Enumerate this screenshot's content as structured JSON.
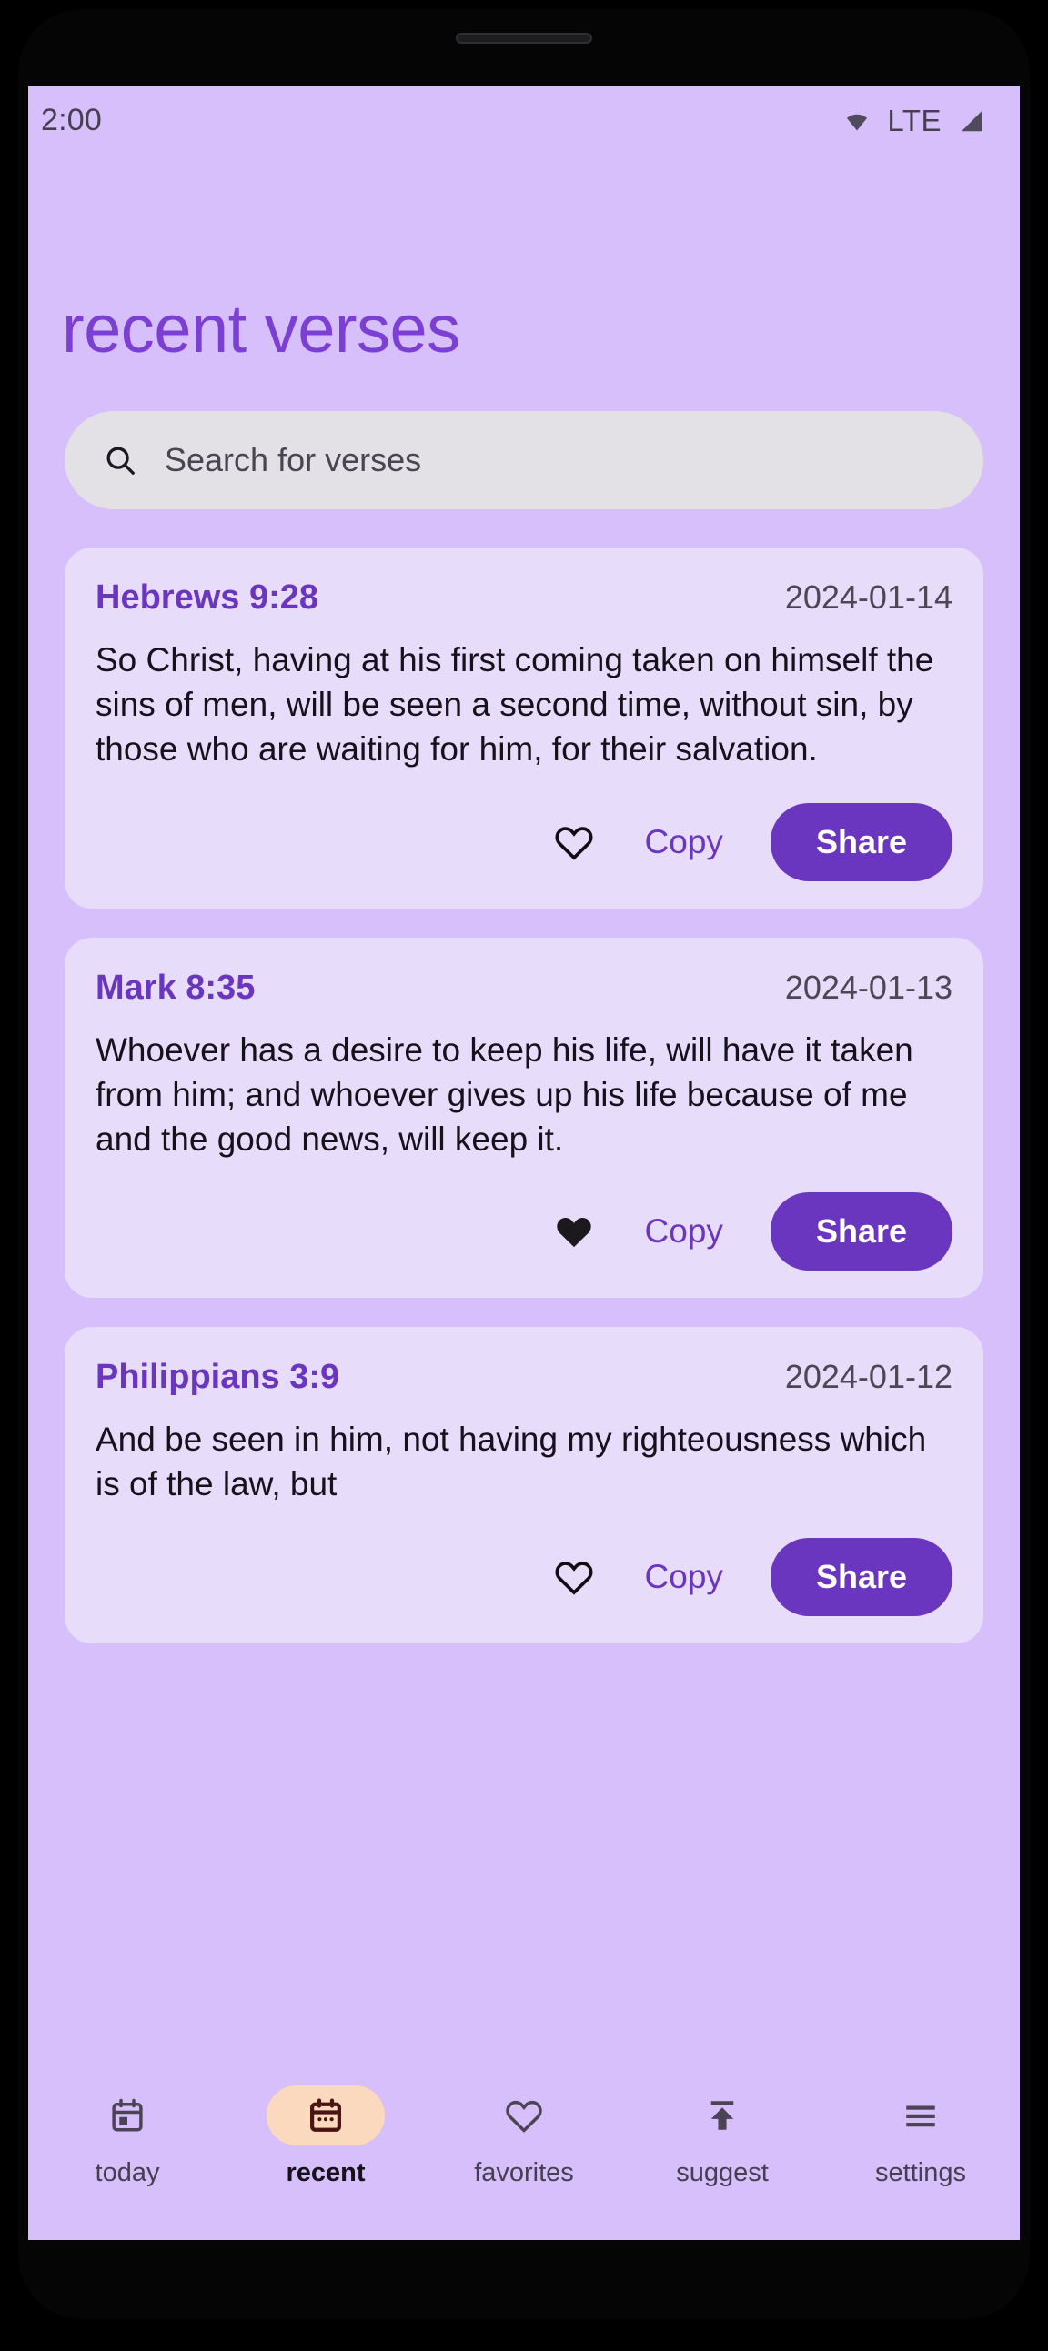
{
  "status_bar": {
    "time": "2:00",
    "network_label": "LTE",
    "wifi_icon": "wifi-icon",
    "signal_icon": "signal-bars-icon"
  },
  "header": {
    "title": "recent verses"
  },
  "search": {
    "placeholder": "Search for verses",
    "value": "",
    "icon": "search-icon"
  },
  "theme": {
    "background": "#D6BFFA",
    "card_background": "#E8DCFB",
    "accent_purple": "#6B36BF",
    "title_purple": "#7B3FD4",
    "active_pill": "#FBD9BE",
    "search_field": "#E3E0E6",
    "body_text": "#16121C",
    "muted_text": "#4C4754"
  },
  "cards": [
    {
      "reference": "Hebrews 9:28",
      "date": "2024-01-14",
      "text": "So Christ, having at his first coming taken on himself the sins of men, will be seen a second time, without sin, by those who are waiting for him, for their salvation.",
      "favorited": false,
      "favorite_icon": "heart-outline-icon",
      "copy_label": "Copy",
      "share_label": "Share"
    },
    {
      "reference": "Mark 8:35",
      "date": "2024-01-13",
      "text": "Whoever has a desire to keep his life, will have it taken from him; and whoever gives up his life because of me and the good news, will keep it.",
      "favorited": true,
      "favorite_icon": "heart-filled-icon",
      "copy_label": "Copy",
      "share_label": "Share"
    },
    {
      "reference": "Philippians 3:9",
      "date": "2024-01-12",
      "text": "And be seen in him, not having my righteousness which is of the law, but",
      "favorited": false,
      "favorite_icon": "heart-outline-icon",
      "copy_label": "Copy",
      "share_label": "Share"
    }
  ],
  "bottom_nav": {
    "active_index": 1,
    "items": [
      {
        "label": "today",
        "icon": "calendar-today-icon"
      },
      {
        "label": "recent",
        "icon": "calendar-recent-icon"
      },
      {
        "label": "favorites",
        "icon": "heart-outline-icon"
      },
      {
        "label": "suggest",
        "icon": "upload-arrow-icon"
      },
      {
        "label": "settings",
        "icon": "hamburger-menu-icon"
      }
    ]
  }
}
